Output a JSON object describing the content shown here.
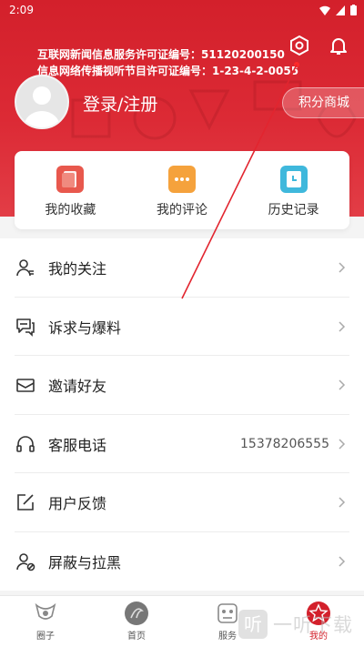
{
  "status_bar": {
    "time": "2:09"
  },
  "header": {
    "license_line_1": "互联网新闻信息服务许可证编号：51120200150",
    "license_line_2": "信息网络传播视听节目许可证编号：1-23-4-2-0055",
    "login_label": "登录/注册",
    "points_mall_label": "积分商城"
  },
  "quick_actions": [
    {
      "label": "我的收藏",
      "icon": "bookmark-icon",
      "color": "#e8584d"
    },
    {
      "label": "我的评论",
      "icon": "comment-icon",
      "color": "#f5a23c"
    },
    {
      "label": "历史记录",
      "icon": "history-icon",
      "color": "#3fb8dc"
    }
  ],
  "menu": [
    {
      "label": "我的关注",
      "icon": "follow-user-icon",
      "value": ""
    },
    {
      "label": "诉求与爆料",
      "icon": "chat-icon",
      "value": ""
    },
    {
      "label": "邀请好友",
      "icon": "envelope-icon",
      "value": ""
    },
    {
      "label": "客服电话",
      "icon": "headset-icon",
      "value": "15378206555"
    },
    {
      "label": "用户反馈",
      "icon": "edit-icon",
      "value": ""
    },
    {
      "label": "屏蔽与拉黑",
      "icon": "block-user-icon",
      "value": ""
    }
  ],
  "tabbar": [
    {
      "label": "圈子",
      "icon": "circle-tab-icon",
      "active": false
    },
    {
      "label": "首页",
      "icon": "home-tab-icon",
      "active": false
    },
    {
      "label": "服务",
      "icon": "service-tab-icon",
      "active": false
    },
    {
      "label": "我的",
      "icon": "mine-tab-icon",
      "active": true
    }
  ],
  "watermark": {
    "text": "一听下载"
  },
  "colors": {
    "brand_red": "#d3202b",
    "text_dark": "#222222",
    "divider": "#ececec"
  }
}
